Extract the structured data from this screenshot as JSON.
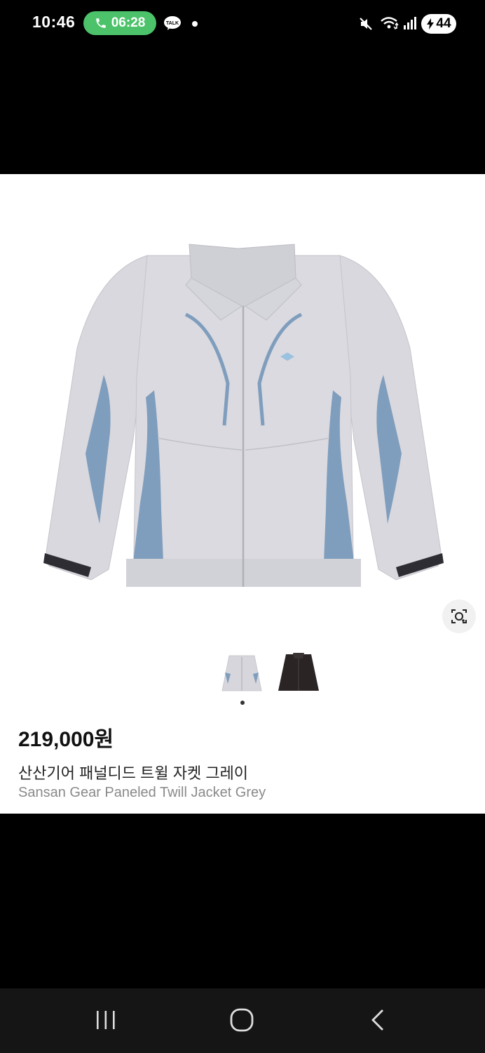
{
  "status_bar": {
    "time": "10:46",
    "call_timer": "06:28",
    "talk_icon_label": "TALK",
    "battery_level": "44"
  },
  "product": {
    "price": "219,000원",
    "name_korean": "산산기어 패널디드 트윌 자켓 그레이",
    "name_english": "Sansan Gear Paneled Twill Jacket Grey",
    "image_count": 2,
    "current_image": 1
  },
  "colors": {
    "call_pill": "#4cc26a",
    "jacket_grey": "#d6d6dc",
    "jacket_blue": "#7f9dbd"
  },
  "icons": {
    "lens": "visual-search-icon",
    "nav_recent": "recent-apps-icon",
    "nav_home": "home-icon",
    "nav_back": "back-icon"
  }
}
